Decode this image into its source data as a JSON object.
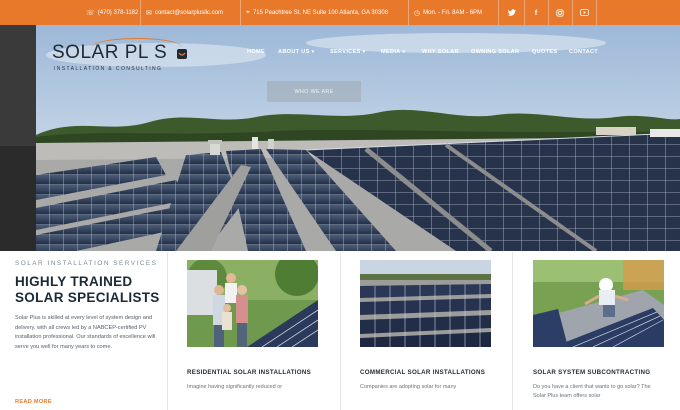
{
  "topbar": {
    "phone": "(470) 378-1182",
    "email": "contact@solarplusllc.com",
    "address": "715 Peachtree St. NE Suite 100 Atlanta, GA 30308",
    "hours": "Mon. - Fri. 8AM - 6PM",
    "social": [
      "twitter-icon",
      "facebook-icon",
      "instagram-icon",
      "youtube-icon"
    ],
    "accent": "#e8792b"
  },
  "logo": {
    "main": "SOLAR PL S",
    "sub": "INSTALLATION & CONSULTING"
  },
  "nav": {
    "items": [
      "HOME",
      "ABOUT US",
      "SERVICES",
      "MEDIA",
      "WHY SOLAR",
      "OWNING SOLAR",
      "QUOTES",
      "CONTACT"
    ]
  },
  "hero": {
    "button": "WHO WE ARE"
  },
  "intro": {
    "kicker": "SOLAR INSTALLATION SERVICES",
    "heading": "HIGHLY TRAINED SOLAR SPECIALISTS",
    "body": "Solar Plus is skilled at every level of system design and delivery, with all crews led by a NABCEP-certified PV installation professional. Our standards of excellence will serve you well for many years to come.",
    "readmore": "READ MORE"
  },
  "cards": [
    {
      "title": "RESIDENTIAL SOLAR INSTALLATIONS",
      "body": "Imagine having significantly reduced or"
    },
    {
      "title": "COMMERCIAL SOLAR INSTALLATIONS",
      "body": "Companies are adopting solar for many"
    },
    {
      "title": "SOLAR SYSTEM SUBCONTRACTING",
      "body": "Do you have a client that wants to go solar? The Solar Plus team offers solar"
    }
  ]
}
